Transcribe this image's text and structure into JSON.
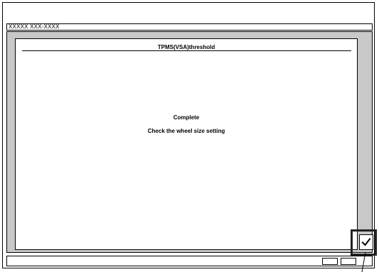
{
  "header": {
    "id_text": "XXXXX XXX-XXXX"
  },
  "dialog": {
    "title": "TPMS(VSA)threshold",
    "status_text": "Complete",
    "instruction_text": "Check the wheel size setting"
  },
  "controls": {
    "confirm_icon": "checkmark-icon",
    "bottom_buttons": [
      "",
      ""
    ]
  }
}
